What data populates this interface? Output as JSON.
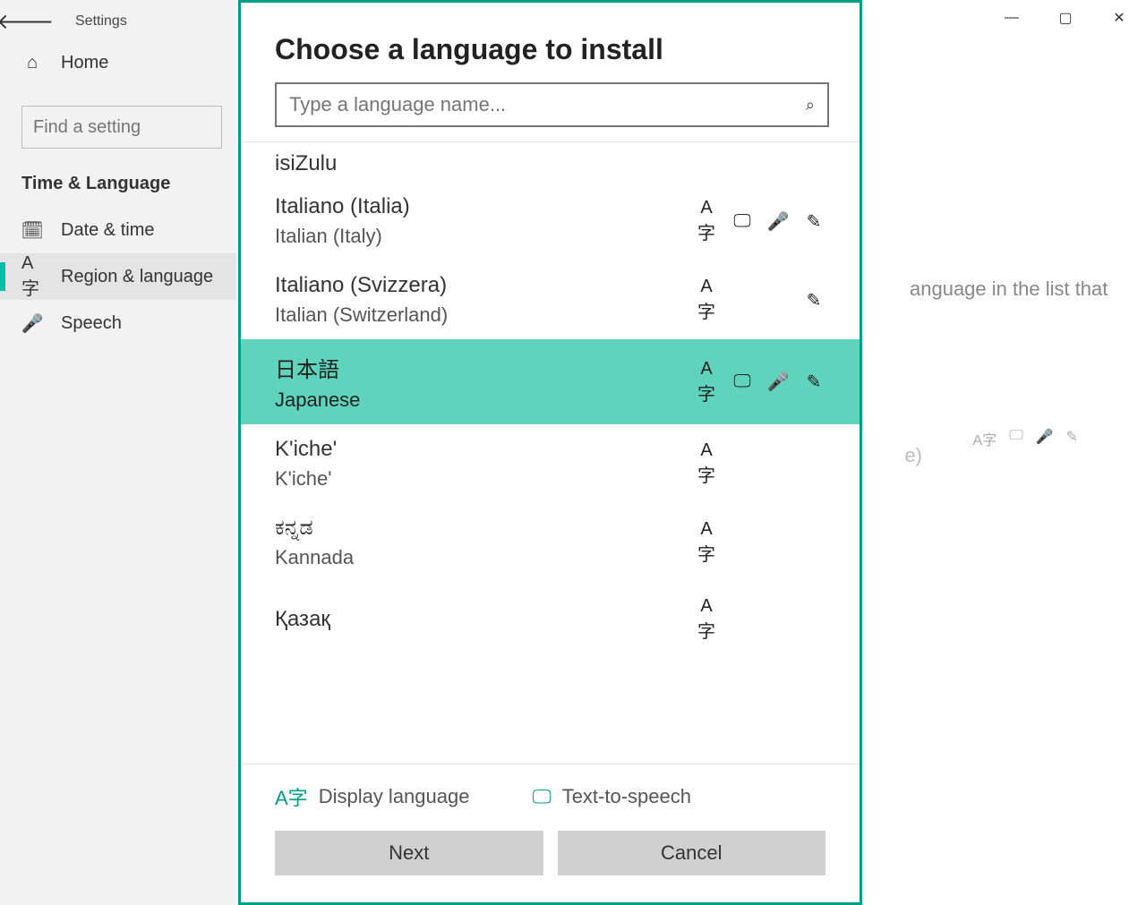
{
  "settings": {
    "title": "Settings",
    "search_placeholder": "Find a setting",
    "group": "Time & Language",
    "items": [
      {
        "icon": "home",
        "label": "Home"
      },
      {
        "icon": "calendar",
        "label": "Date & time"
      },
      {
        "icon": "language",
        "label": "Region & language"
      },
      {
        "icon": "mic",
        "label": "Speech"
      }
    ],
    "right_hint": "anguage in the list that",
    "right_tail": "e)"
  },
  "dialog": {
    "title": "Choose a language to install",
    "search_placeholder": "Type a language name...",
    "selected_index": 3,
    "languages": [
      {
        "native": "isiZulu",
        "english": "",
        "features": []
      },
      {
        "native": "Italiano (Italia)",
        "english": "Italian (Italy)",
        "features": [
          "display",
          "tts",
          "speech",
          "handwriting"
        ]
      },
      {
        "native": "Italiano (Svizzera)",
        "english": "Italian (Switzerland)",
        "features": [
          "display",
          "handwriting"
        ]
      },
      {
        "native": "日本語",
        "english": "Japanese",
        "features": [
          "display",
          "tts",
          "speech",
          "handwriting"
        ]
      },
      {
        "native": "K'iche'",
        "english": "K'iche'",
        "features": [
          "display"
        ]
      },
      {
        "native": "ಕನ್ನಡ",
        "english": "Kannada",
        "features": [
          "display"
        ]
      },
      {
        "native": "Қазақ",
        "english": "",
        "features": [
          "display"
        ]
      }
    ],
    "legend": {
      "display": "Display language",
      "tts": "Text-to-speech"
    },
    "buttons": {
      "next": "Next",
      "cancel": "Cancel"
    }
  }
}
